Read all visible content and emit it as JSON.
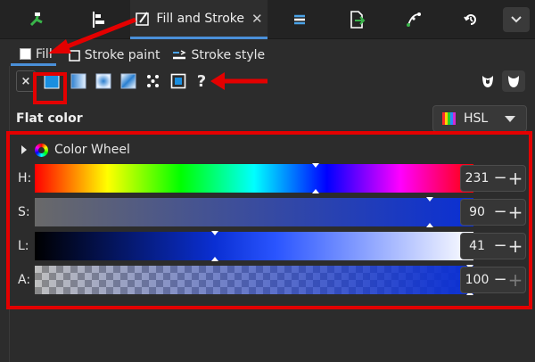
{
  "dock_tabs": [
    {
      "id": "node-tool",
      "icon": "node-editor-icon"
    },
    {
      "id": "align",
      "icon": "align-distribute-icon"
    },
    {
      "id": "fill-stroke",
      "icon": "fill-stroke-icon",
      "label": "Fill and Stroke",
      "active": true
    },
    {
      "id": "layers",
      "icon": "layers-icon"
    },
    {
      "id": "export",
      "icon": "export-icon"
    },
    {
      "id": "path-effects",
      "icon": "path-effects-icon"
    },
    {
      "id": "undo-history",
      "icon": "undo-history-icon"
    }
  ],
  "subtabs": {
    "fill": "Fill",
    "stroke_paint": "Stroke paint",
    "stroke_style": "Stroke style"
  },
  "paint_types": [
    "none",
    "flat",
    "linear",
    "radial",
    "mesh",
    "pattern",
    "swatch",
    "unset"
  ],
  "paint_unset_label": "?",
  "paint_none_label": "×",
  "flat_color": {
    "title": "Flat color",
    "mode": "HSL",
    "wheel_label": "Color Wheel"
  },
  "sliders": [
    {
      "key": "H",
      "label": "H:",
      "value": "231",
      "fraction": 0.641
    },
    {
      "key": "S",
      "label": "S:",
      "value": "90",
      "fraction": 0.9
    },
    {
      "key": "L",
      "label": "L:",
      "value": "41",
      "fraction": 0.41
    },
    {
      "key": "A",
      "label": "A:",
      "value": "100",
      "fraction": 1.0
    }
  ],
  "colors": {
    "accent": "#4a90d9",
    "annotation": "#e40000",
    "current_color": "#0a2fd3"
  }
}
